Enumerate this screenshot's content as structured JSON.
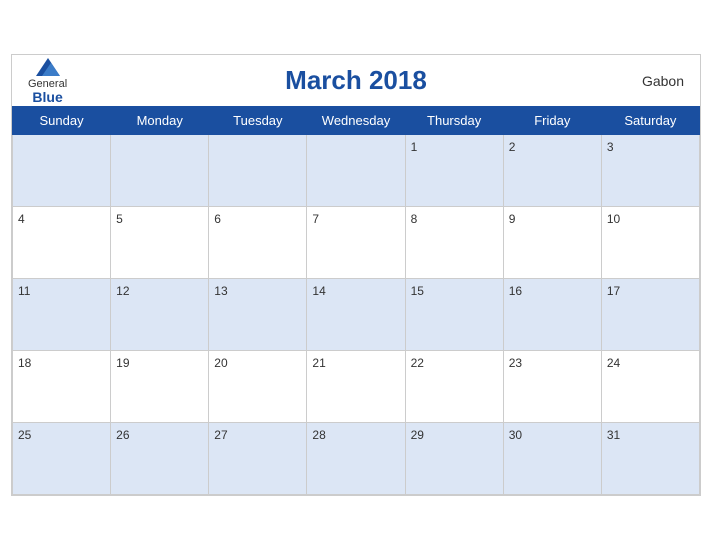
{
  "header": {
    "logo_general": "General",
    "logo_blue": "Blue",
    "month_title": "March 2018",
    "country": "Gabon"
  },
  "weekdays": [
    "Sunday",
    "Monday",
    "Tuesday",
    "Wednesday",
    "Thursday",
    "Friday",
    "Saturday"
  ],
  "weeks": [
    [
      {
        "day": "",
        "month": "current"
      },
      {
        "day": "",
        "month": "current"
      },
      {
        "day": "",
        "month": "current"
      },
      {
        "day": "",
        "month": "current"
      },
      {
        "day": "1",
        "month": "current"
      },
      {
        "day": "2",
        "month": "current"
      },
      {
        "day": "3",
        "month": "current"
      }
    ],
    [
      {
        "day": "4",
        "month": "current"
      },
      {
        "day": "5",
        "month": "current"
      },
      {
        "day": "6",
        "month": "current"
      },
      {
        "day": "7",
        "month": "current"
      },
      {
        "day": "8",
        "month": "current"
      },
      {
        "day": "9",
        "month": "current"
      },
      {
        "day": "10",
        "month": "current"
      }
    ],
    [
      {
        "day": "11",
        "month": "current"
      },
      {
        "day": "12",
        "month": "current"
      },
      {
        "day": "13",
        "month": "current"
      },
      {
        "day": "14",
        "month": "current"
      },
      {
        "day": "15",
        "month": "current"
      },
      {
        "day": "16",
        "month": "current"
      },
      {
        "day": "17",
        "month": "current"
      }
    ],
    [
      {
        "day": "18",
        "month": "current"
      },
      {
        "day": "19",
        "month": "current"
      },
      {
        "day": "20",
        "month": "current"
      },
      {
        "day": "21",
        "month": "current"
      },
      {
        "day": "22",
        "month": "current"
      },
      {
        "day": "23",
        "month": "current"
      },
      {
        "day": "24",
        "month": "current"
      }
    ],
    [
      {
        "day": "25",
        "month": "current"
      },
      {
        "day": "26",
        "month": "current"
      },
      {
        "day": "27",
        "month": "current"
      },
      {
        "day": "28",
        "month": "current"
      },
      {
        "day": "29",
        "month": "current"
      },
      {
        "day": "30",
        "month": "current"
      },
      {
        "day": "31",
        "month": "current"
      }
    ]
  ]
}
